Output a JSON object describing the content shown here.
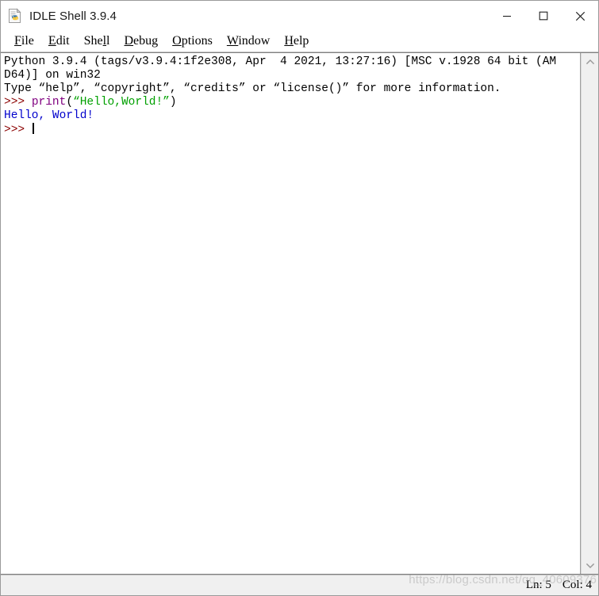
{
  "window": {
    "title": "IDLE Shell 3.9.4",
    "icon": "idle-python-document-icon",
    "controls": {
      "minimize": "minimize-button",
      "maximize": "maximize-button",
      "close": "close-button"
    }
  },
  "menubar": {
    "items": [
      {
        "label": "File",
        "pre": "",
        "accel": "F",
        "post": "ile"
      },
      {
        "label": "Edit",
        "pre": "",
        "accel": "E",
        "post": "dit"
      },
      {
        "label": "Shell",
        "pre": "She",
        "accel": "l",
        "post": "l"
      },
      {
        "label": "Debug",
        "pre": "",
        "accel": "D",
        "post": "ebug"
      },
      {
        "label": "Options",
        "pre": "",
        "accel": "O",
        "post": "ptions"
      },
      {
        "label": "Window",
        "pre": "",
        "accel": "W",
        "post": "indow"
      },
      {
        "label": "Help",
        "pre": "",
        "accel": "H",
        "post": "elp"
      }
    ]
  },
  "shell": {
    "lines": [
      {
        "id": "banner-line-1",
        "segments": [
          {
            "text": "Python 3.9.4 (tags/v3.9.4:1f2e308, Apr  4 2021, 13:27:16) [MSC v.1928 64 bit (AM",
            "style": "plain"
          }
        ]
      },
      {
        "id": "banner-line-2",
        "segments": [
          {
            "text": "D64)] on win32",
            "style": "plain"
          }
        ]
      },
      {
        "id": "banner-line-3",
        "segments": [
          {
            "text": "Type “help”, “copyright”, “credits” or “license()” for more information.",
            "style": "plain"
          }
        ]
      },
      {
        "id": "input-line-1",
        "segments": [
          {
            "text": ">>> ",
            "style": "prompt"
          },
          {
            "text": "print",
            "style": "builtin"
          },
          {
            "text": "(",
            "style": "plain"
          },
          {
            "text": "“Hello,World!”",
            "style": "string"
          },
          {
            "text": ")",
            "style": "plain"
          }
        ]
      },
      {
        "id": "output-line-1",
        "segments": [
          {
            "text": "Hello, World!",
            "style": "stdout"
          }
        ]
      },
      {
        "id": "prompt-line-current",
        "segments": [
          {
            "text": ">>> ",
            "style": "prompt"
          }
        ],
        "caret": true
      }
    ]
  },
  "scrollbar": {
    "up_arrow": "chevron-up-icon",
    "down_arrow": "chevron-down-icon"
  },
  "statusbar": {
    "line": "Ln: 5",
    "column": "Col: 4"
  },
  "watermark": {
    "text": "https://blog.csdn.net/qq_40609376"
  },
  "colors": {
    "prompt": "#8b0000",
    "builtin": "#800080",
    "string": "#00a000",
    "stdout": "#0000cc",
    "plain": "#000000",
    "window_bg": "#ffffff",
    "chrome_bg": "#f0f0f0"
  }
}
